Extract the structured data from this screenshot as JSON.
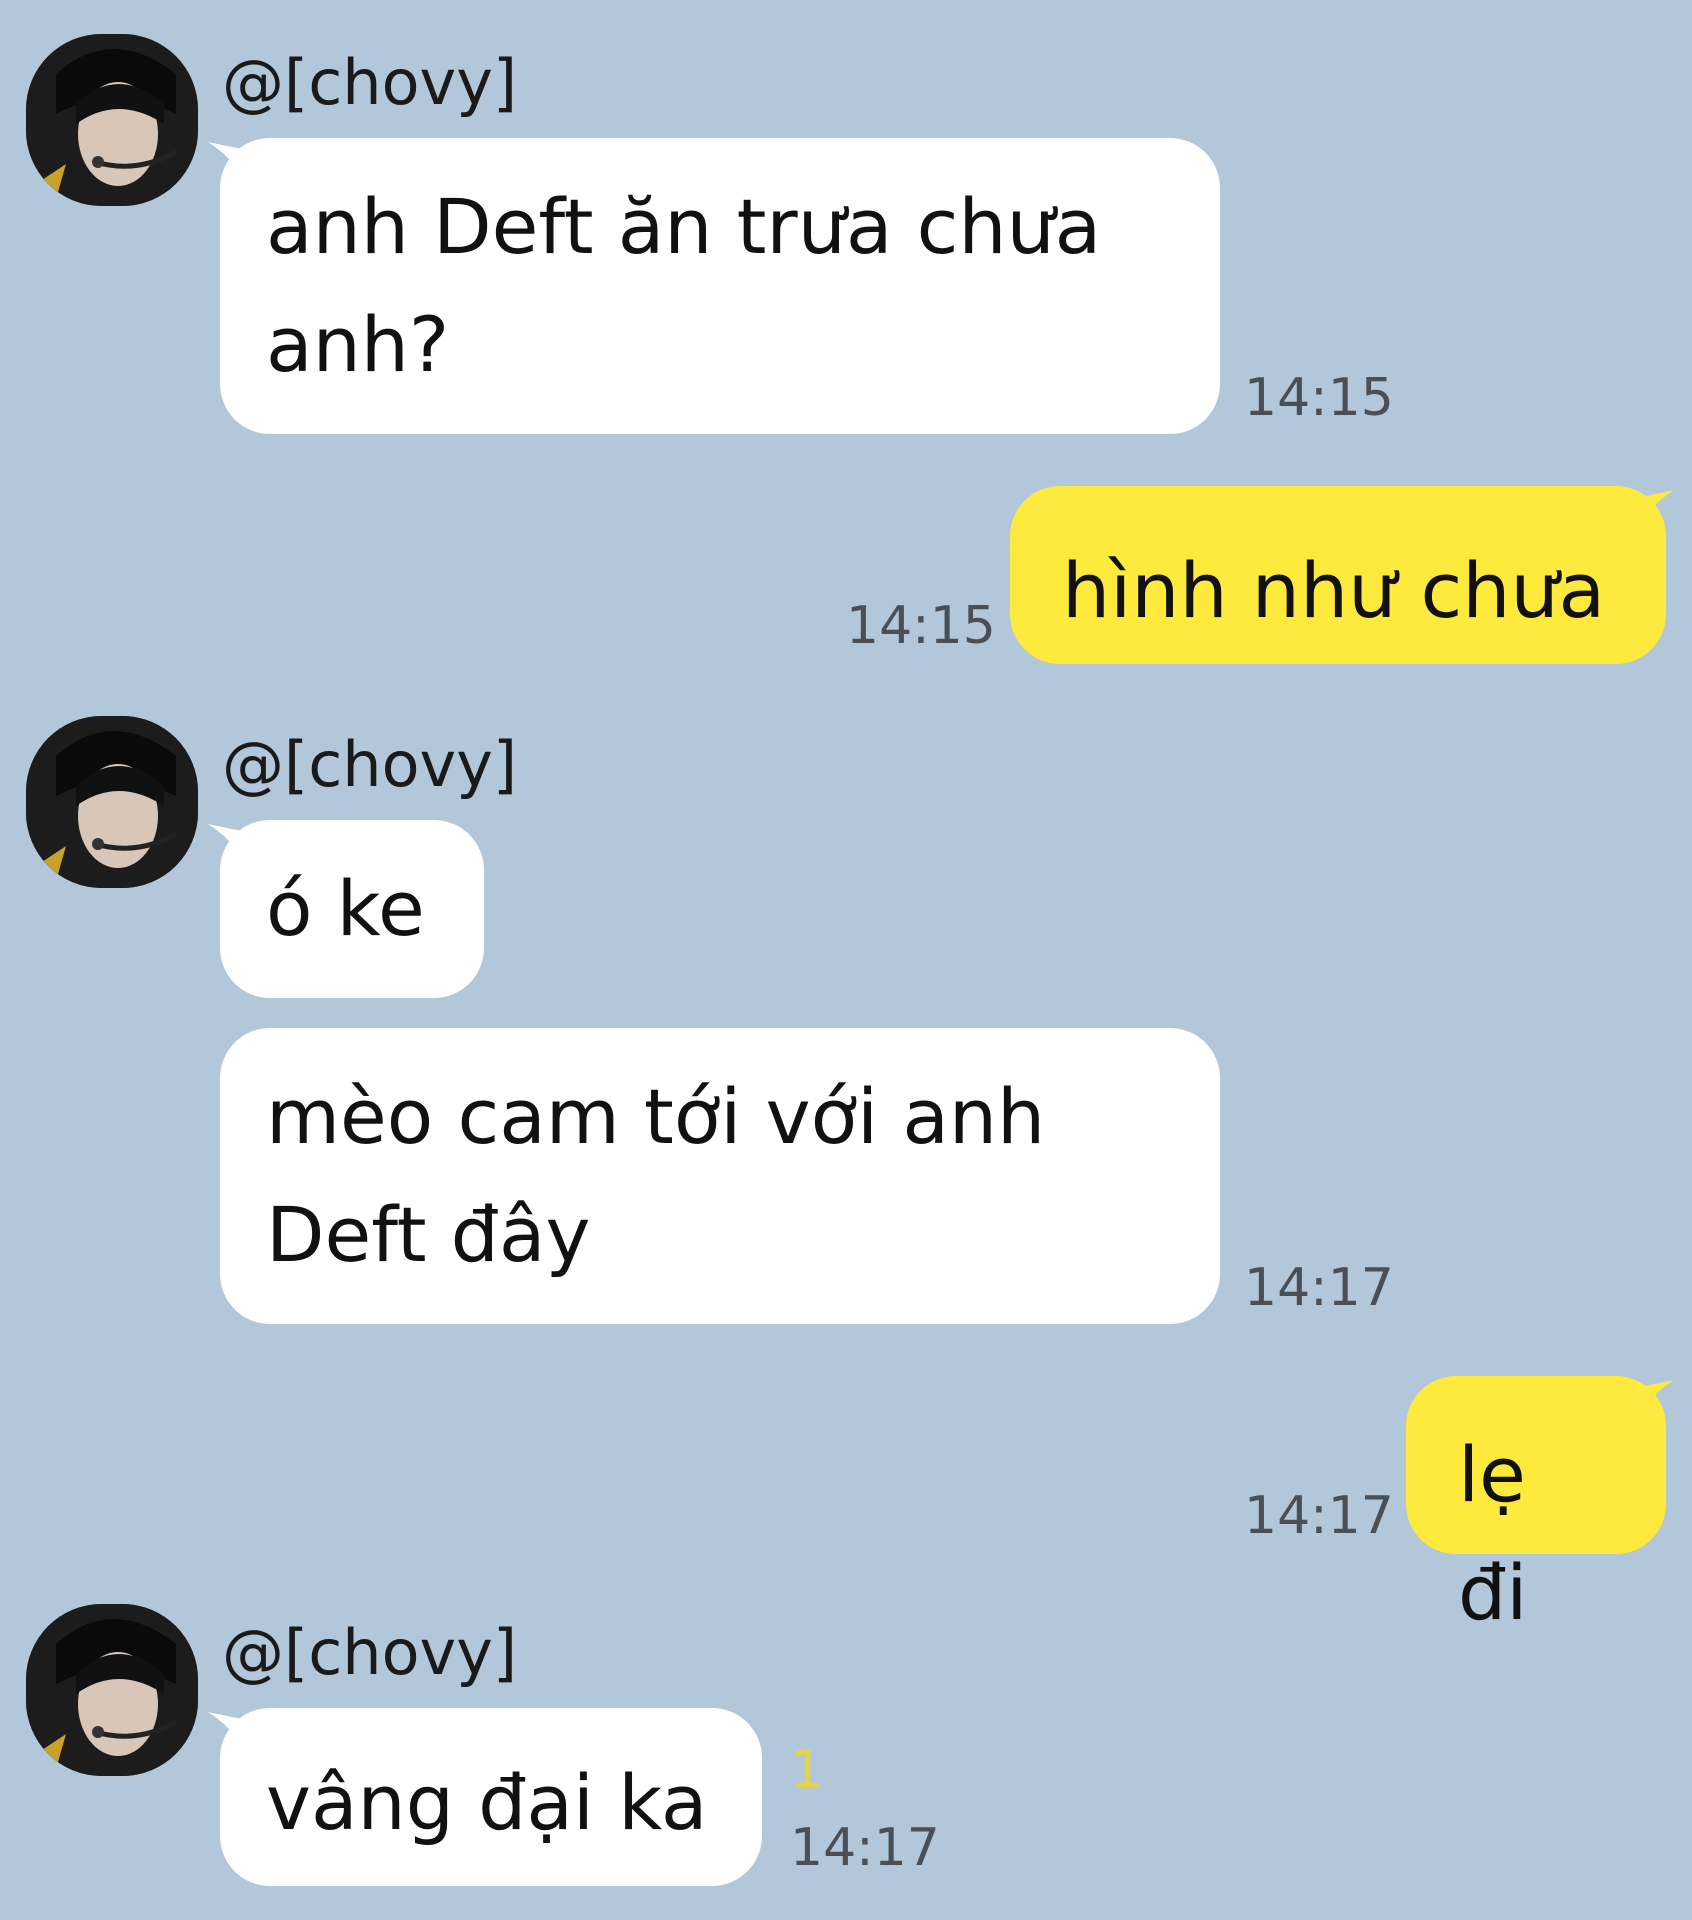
{
  "colors": {
    "background": "#b2c7d9",
    "incoming_bubble": "#ffffff",
    "outgoing_bubble": "#fdea3c",
    "timestamp": "#4a4e55",
    "unread_count": "#e9d53b"
  },
  "messages": [
    {
      "sender": "@[chovy]",
      "text": "anh Deft ăn trưa chưa\nanh?",
      "time": "14:15"
    },
    {
      "text": "hình như chưa",
      "time": "14:15"
    },
    {
      "sender": "@[chovy]",
      "text": "ó ke"
    },
    {
      "text": "mèo cam tới với anh\nDeft đây",
      "time": "14:17"
    },
    {
      "text": "lẹ đi",
      "time": "14:17"
    },
    {
      "sender": "@[chovy]",
      "text": "vâng đại ka",
      "time": "14:17",
      "unread": "1"
    }
  ]
}
